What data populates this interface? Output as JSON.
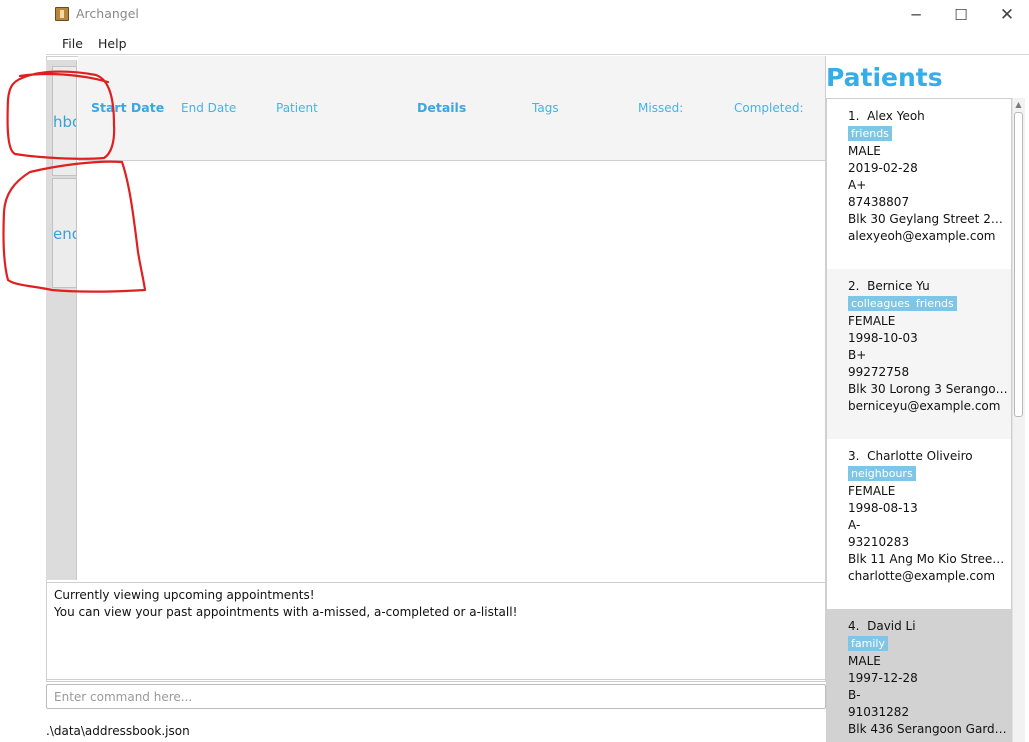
{
  "window": {
    "title": "Archangel",
    "icon": "archangel-app-icon",
    "controls": {
      "minimize": "─",
      "maximize": "☐",
      "close": "✕"
    }
  },
  "menu": {
    "file": "File",
    "help": "Help"
  },
  "tabs": [
    {
      "label": "hbo",
      "full": "Dashboard"
    },
    {
      "label": "end",
      "full": "Calendar"
    }
  ],
  "appointments": {
    "columns": {
      "start": "Start Date",
      "end": "End Date",
      "patient": "Patient",
      "details": "Details",
      "tags": "Tags",
      "missed": "Missed:",
      "completed": "Completed:"
    },
    "rows": []
  },
  "result": {
    "line1": "Currently viewing upcoming appointments!",
    "line2": "You can view your past appointments with a-missed, a-completed or a-listall!"
  },
  "command": {
    "value": "",
    "placeholder": "Enter command here..."
  },
  "status": {
    "path": ".\\data\\addressbook.json"
  },
  "patients": {
    "title": "Patients",
    "list": [
      {
        "index": "1.",
        "name": "Alex Yeoh",
        "tags": [
          "friends"
        ],
        "gender": "MALE",
        "dob": "2019-02-28",
        "blood": "A+",
        "phone": "87438807",
        "address": "Blk 30 Geylang Street 29, ...",
        "email": "alexyeoh@example.com"
      },
      {
        "index": "2.",
        "name": "Bernice Yu",
        "tags": [
          "colleagues",
          "friends"
        ],
        "gender": "FEMALE",
        "dob": "1998-10-03",
        "blood": "B+",
        "phone": "99272758",
        "address": "Blk 30 Lorong 3 Serangoo...",
        "email": "berniceyu@example.com"
      },
      {
        "index": "3.",
        "name": "Charlotte Oliveiro",
        "tags": [
          "neighbours"
        ],
        "gender": "FEMALE",
        "dob": "1998-08-13",
        "blood": "A-",
        "phone": "93210283",
        "address": "Blk 11 Ang Mo Kio Street ...",
        "email": "charlotte@example.com"
      },
      {
        "index": "4.",
        "name": "David Li",
        "tags": [
          "family"
        ],
        "gender": "MALE",
        "dob": "1997-12-28",
        "blood": "B-",
        "phone": "91031282",
        "address": "Blk 436 Serangoon Garde...",
        "email": ""
      }
    ]
  },
  "colors": {
    "accent": "#35aee8",
    "tag": "#7fc6e6",
    "annotation": "#e02020",
    "selected": "#d2d2d2"
  }
}
